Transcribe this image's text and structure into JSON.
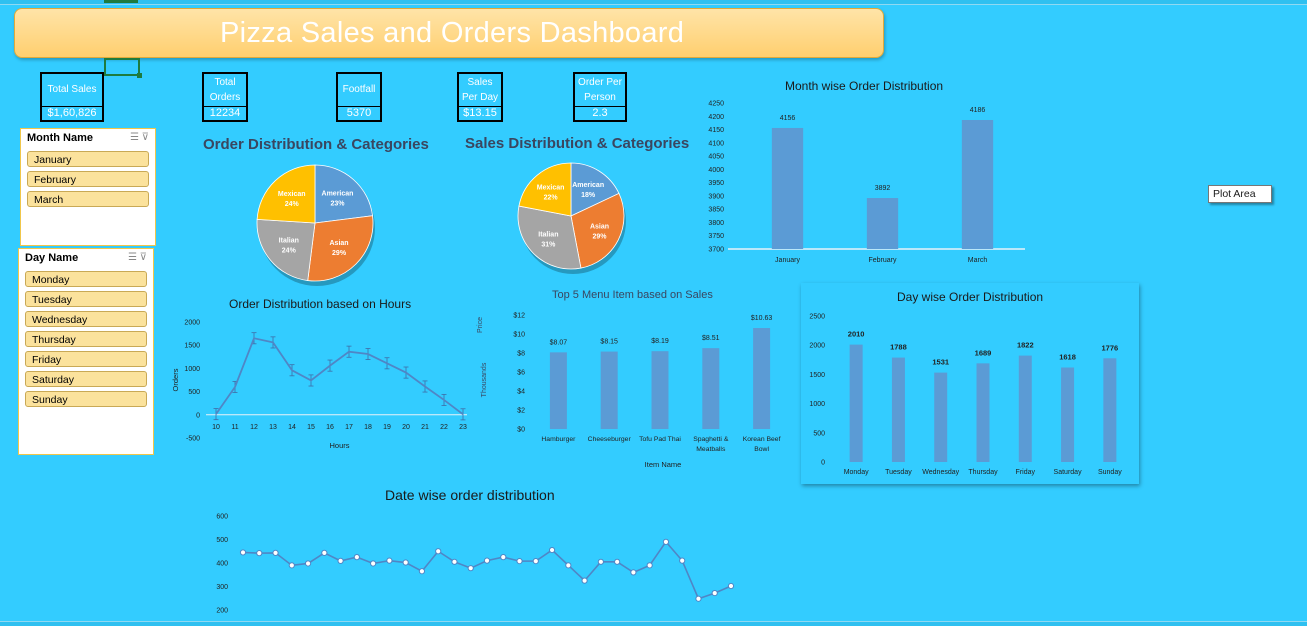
{
  "title": "Pizza Sales and Orders Dashboard",
  "kpis": [
    {
      "label": "Total Sales",
      "value": "$1,60,826"
    },
    {
      "label1": "Total",
      "label2": "Orders",
      "value": "12234"
    },
    {
      "label": "Footfall",
      "value": "5370"
    },
    {
      "label1": "Sales",
      "label2": "Per Day",
      "value": "$13.15"
    },
    {
      "label1": "Order Per",
      "label2": "Person",
      "value": "2.3"
    }
  ],
  "slicers": {
    "month": {
      "title": "Month Name",
      "items": [
        "January",
        "February",
        "March"
      ]
    },
    "day": {
      "title": "Day Name",
      "items": [
        "Monday",
        "Tuesday",
        "Wednesday",
        "Thursday",
        "Friday",
        "Saturday",
        "Sunday"
      ]
    }
  },
  "tooltip": "Plot Area",
  "colors": {
    "background": "#33ccff",
    "bar": "#5b9bd5",
    "american": "#5b9bd5",
    "asian": "#ed7d31",
    "italian": "#a5a5a5",
    "mexican": "#ffc000",
    "banner": "#ffd47a"
  },
  "chart_data": [
    {
      "id": "order_pie",
      "type": "pie",
      "title": "Order Distribution & Categories",
      "labels": [
        "American",
        "Asian",
        "Italian",
        "Mexican"
      ],
      "label_text": [
        "American\n23%",
        "Asian\n29%",
        "Italian\n24%",
        "Mexican\n24%"
      ],
      "values": [
        23,
        29,
        24,
        24
      ]
    },
    {
      "id": "sales_pie",
      "type": "pie",
      "title": "Sales Distribution & Categories",
      "labels": [
        "American",
        "Asian",
        "Italian",
        "Mexican"
      ],
      "label_text": [
        "American\n18%",
        "Asian\n29%",
        "Italian\n31%",
        "Mexican\n22%"
      ],
      "values": [
        18,
        29,
        31,
        22
      ]
    },
    {
      "id": "month_bar",
      "type": "bar",
      "title": "Month wise Order Distribution",
      "categories": [
        "January",
        "February",
        "March"
      ],
      "values": [
        4156,
        3892,
        4186
      ],
      "ylim": [
        3700,
        4250
      ],
      "yticks": [
        3700,
        3750,
        3800,
        3850,
        3900,
        3950,
        4000,
        4050,
        4100,
        4150,
        4200,
        4250
      ]
    },
    {
      "id": "hours_line",
      "type": "line",
      "title": "Order Distribution based on Hours",
      "xlabel": "Hours",
      "ylabel": "Orders",
      "x": [
        10,
        11,
        12,
        13,
        14,
        15,
        16,
        17,
        18,
        19,
        20,
        21,
        22,
        23
      ],
      "values": [
        15,
        600,
        1650,
        1560,
        960,
        740,
        1060,
        1360,
        1310,
        1110,
        910,
        610,
        320,
        10
      ],
      "ylim": [
        -500,
        2000
      ],
      "yticks": [
        -500,
        0,
        500,
        1000,
        1500,
        2000
      ]
    },
    {
      "id": "menu_bar",
      "type": "bar",
      "title": "Top 5 Menu Item based on Sales",
      "xlabel": "Item Name",
      "ylabel": "Price",
      "ylabel2": "Thousands",
      "categories": [
        "Hamburger",
        "Cheeseburger",
        "Tofu Pad Thai",
        "Spaghetti &\nMeatballs",
        "Korean Beef\nBowl"
      ],
      "values": [
        8.07,
        8.15,
        8.19,
        8.51,
        10.63
      ],
      "value_labels": [
        "$8.07",
        "$8.15",
        "$8.19",
        "$8.51",
        "$10.63"
      ],
      "ylim": [
        0,
        12
      ],
      "ytick_labels": [
        "$0",
        "$2",
        "$4",
        "$6",
        "$8",
        "$10",
        "$12"
      ]
    },
    {
      "id": "day_bar",
      "type": "bar",
      "title": "Day wise Order Distribution",
      "categories": [
        "Monday",
        "Tuesday",
        "Wednesday",
        "Thursday",
        "Friday",
        "Saturday",
        "Sunday"
      ],
      "values": [
        2010,
        1788,
        1531,
        1689,
        1822,
        1618,
        1776
      ],
      "ylim": [
        0,
        2500
      ],
      "yticks": [
        0,
        500,
        1000,
        1500,
        2000,
        2500
      ]
    },
    {
      "id": "date_line",
      "type": "line",
      "title": "Date wise order distribution",
      "values": [
        445,
        442,
        443,
        390,
        398,
        443,
        409,
        425,
        398,
        410,
        402,
        365,
        450,
        405,
        378,
        410,
        425,
        408,
        408,
        455,
        390,
        325,
        405,
        405,
        360,
        390,
        490,
        410,
        248,
        272,
        302
      ],
      "ylim": [
        200,
        600
      ],
      "yticks": [
        200,
        300,
        400,
        500,
        600
      ]
    }
  ]
}
